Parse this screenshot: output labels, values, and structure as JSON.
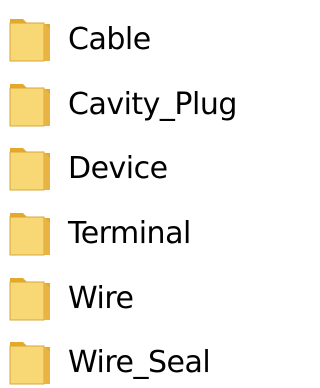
{
  "explorer": {
    "colors": {
      "folder_front": "#f8d775",
      "folder_back": "#e4a92b",
      "folder_edge": "#d9a637",
      "label_text": "#000000",
      "background": "#ffffff"
    },
    "items": [
      {
        "label": "Cable",
        "icon": "folder-icon"
      },
      {
        "label": "Cavity_Plug",
        "icon": "folder-icon"
      },
      {
        "label": "Device",
        "icon": "folder-icon"
      },
      {
        "label": "Terminal",
        "icon": "folder-icon"
      },
      {
        "label": "Wire",
        "icon": "folder-icon"
      },
      {
        "label": "Wire_Seal",
        "icon": "folder-icon"
      }
    ]
  }
}
